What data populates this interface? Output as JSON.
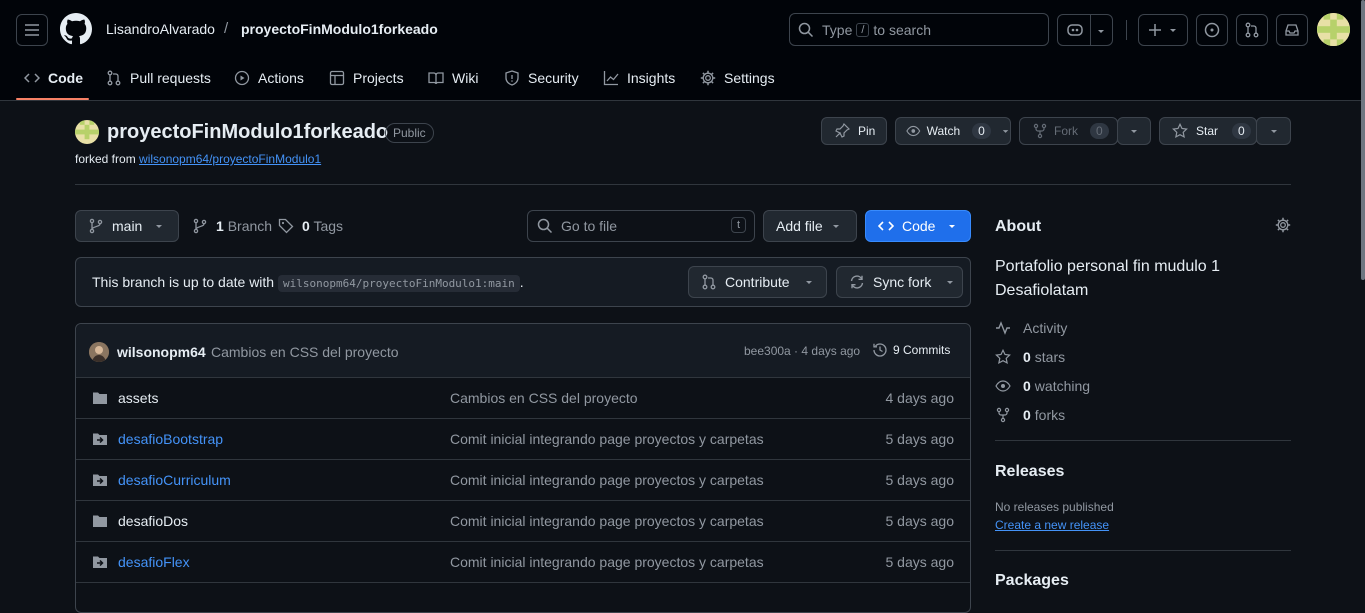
{
  "header": {
    "owner": "LisandroAlvarado",
    "separator": "/",
    "repo": "proyectoFinModulo1forkeado",
    "search_prefix": "Type",
    "search_key": "/",
    "search_suffix": "to search"
  },
  "tabs": [
    {
      "label": "Code",
      "icon": "code-icon"
    },
    {
      "label": "Pull requests",
      "icon": "pull-request-icon"
    },
    {
      "label": "Actions",
      "icon": "play-icon"
    },
    {
      "label": "Projects",
      "icon": "table-icon"
    },
    {
      "label": "Wiki",
      "icon": "book-icon"
    },
    {
      "label": "Security",
      "icon": "shield-icon"
    },
    {
      "label": "Insights",
      "icon": "graph-icon"
    },
    {
      "label": "Settings",
      "icon": "gear-icon"
    }
  ],
  "repo": {
    "name": "proyectoFinModulo1forkeado",
    "visibility": "Public",
    "forked_from_label": "forked from",
    "forked_from": "wilsonopm64/proyectoFinModulo1",
    "pin_label": "Pin",
    "watch_label": "Watch",
    "watch_count": "0",
    "fork_label": "Fork",
    "fork_count": "0",
    "star_label": "Star",
    "star_count": "0"
  },
  "toolbar": {
    "branch": "main",
    "branch_count": "1",
    "branch_label": "Branch",
    "tag_count": "0",
    "tag_label": "Tags",
    "goto_placeholder": "Go to file",
    "goto_key": "t",
    "add_file": "Add file",
    "code": "Code"
  },
  "sync": {
    "text": "This branch is up to date with",
    "ref": "wilsonopm64/proyectoFinModulo1:main",
    "dot": ".",
    "contribute": "Contribute",
    "sync_fork": "Sync fork"
  },
  "commit": {
    "author": "wilsonopm64",
    "message": "Cambios en CSS del proyecto",
    "meta": "bee300a · 4 days ago",
    "commits": "9 Commits"
  },
  "files": [
    {
      "name": "assets",
      "type": "folder",
      "message": "Cambios en CSS del proyecto",
      "date": "4 days ago"
    },
    {
      "name": "desafioBootstrap",
      "type": "submodule",
      "message": "Comit inicial integrando page proyectos y carpetas",
      "date": "5 days ago"
    },
    {
      "name": "desafioCurriculum",
      "type": "submodule",
      "message": "Comit inicial integrando page proyectos y carpetas",
      "date": "5 days ago"
    },
    {
      "name": "desafioDos",
      "type": "folder",
      "message": "Comit inicial integrando page proyectos y carpetas",
      "date": "5 days ago"
    },
    {
      "name": "desafioFlex",
      "type": "submodule",
      "message": "Comit inicial integrando page proyectos y carpetas",
      "date": "5 days ago"
    }
  ],
  "about": {
    "title": "About",
    "description": "Portafolio personal fin mudulo 1 Desafiolatam",
    "activity": "Activity",
    "stars_count": "0",
    "stars_label": "stars",
    "watching_count": "0",
    "watching_label": "watching",
    "forks_count": "0",
    "forks_label": "forks"
  },
  "releases": {
    "title": "Releases",
    "none": "No releases published",
    "create": "Create a new release"
  },
  "packages": {
    "title": "Packages"
  },
  "colors": {
    "accent": "#4493f8",
    "primary_button": "#1f6feb",
    "background": "#0d1117",
    "header": "#010409",
    "tab_underline": "#f78166"
  }
}
